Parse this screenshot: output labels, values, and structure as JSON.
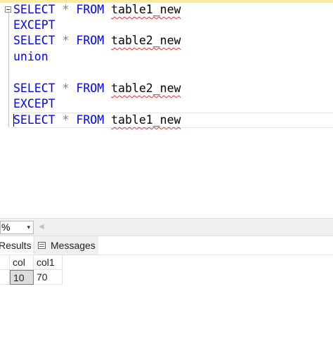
{
  "editor": {
    "lines": [
      {
        "kw": "SELECT",
        "op": "*",
        "kw2": "FROM",
        "table": "table1_new"
      },
      {
        "kw": "EXCEPT"
      },
      {
        "kw": "SELECT",
        "op": "*",
        "kw2": "FROM",
        "table": "table2_new"
      },
      {
        "kw": "union"
      },
      {
        "kw": "SELECT",
        "op": "*",
        "kw2": "FROM",
        "table": "table2_new"
      },
      {
        "kw": "EXCEPT"
      },
      {
        "kw": "SELECT",
        "op": "*",
        "kw2": "FROM",
        "table": "table1_new"
      }
    ]
  },
  "zoom": {
    "value": "%",
    "arrow": "▾",
    "scroll_left": "◀"
  },
  "tabs": [
    {
      "label": "Results"
    },
    {
      "label": "Messages"
    }
  ],
  "grid": {
    "columns": [
      "col",
      "col1"
    ],
    "rows": [
      [
        "10",
        "70"
      ]
    ]
  },
  "colors": {
    "keyword": "#0000ff",
    "operator": "#808080",
    "squiggle": "#e03030"
  }
}
